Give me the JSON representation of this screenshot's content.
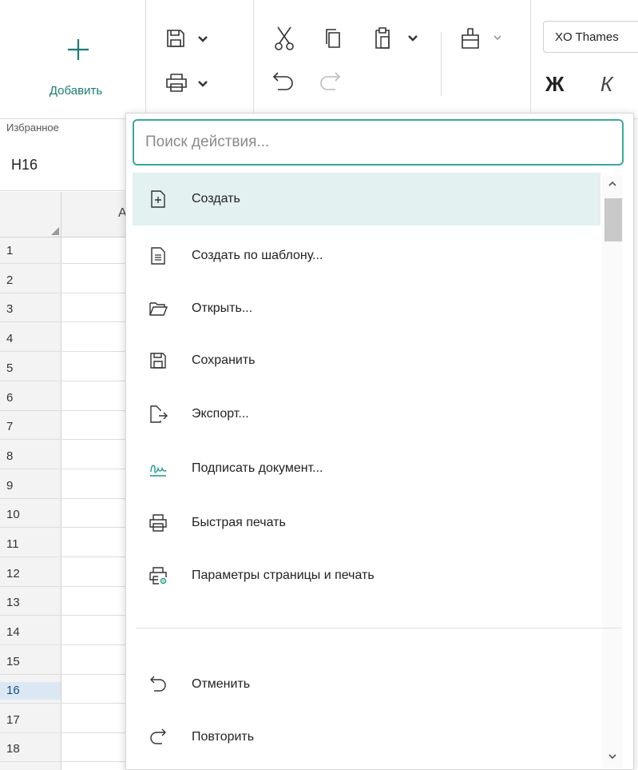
{
  "ribbon": {
    "add_label": "Добавить",
    "group_label": "Избранное",
    "font_name": "XO Thames",
    "bold_label": "Ж",
    "italic_label": "К"
  },
  "namebox": {
    "cell": "H16"
  },
  "grid": {
    "column_a": "A",
    "rows": [
      "1",
      "2",
      "3",
      "4",
      "5",
      "6",
      "7",
      "8",
      "9",
      "10",
      "11",
      "12",
      "13",
      "14",
      "15",
      "16",
      "17",
      "18"
    ],
    "selected_row": "16"
  },
  "dropdown": {
    "search_placeholder": "Поиск действия...",
    "items": [
      {
        "label": "Создать",
        "icon": "new-document-icon"
      },
      {
        "label": "Создать по шаблону...",
        "icon": "template-document-icon"
      },
      {
        "label": "Открыть...",
        "icon": "folder-open-icon"
      },
      {
        "label": "Сохранить",
        "icon": "save-icon"
      },
      {
        "label": "Экспорт...",
        "icon": "export-icon"
      },
      {
        "label": "Подписать документ...",
        "icon": "signature-icon"
      },
      {
        "label": "Быстрая печать",
        "icon": "printer-icon"
      },
      {
        "label": "Параметры страницы и печать",
        "icon": "page-setup-print-icon"
      },
      {
        "label": "Отменить",
        "icon": "undo-icon"
      },
      {
        "label": "Повторить",
        "icon": "redo-icon"
      }
    ]
  },
  "colors": {
    "accent": "#1b7c72",
    "search_border": "#3aa79b",
    "active_item": "#e3f1f0",
    "selected_row": "#dbe8f4"
  }
}
